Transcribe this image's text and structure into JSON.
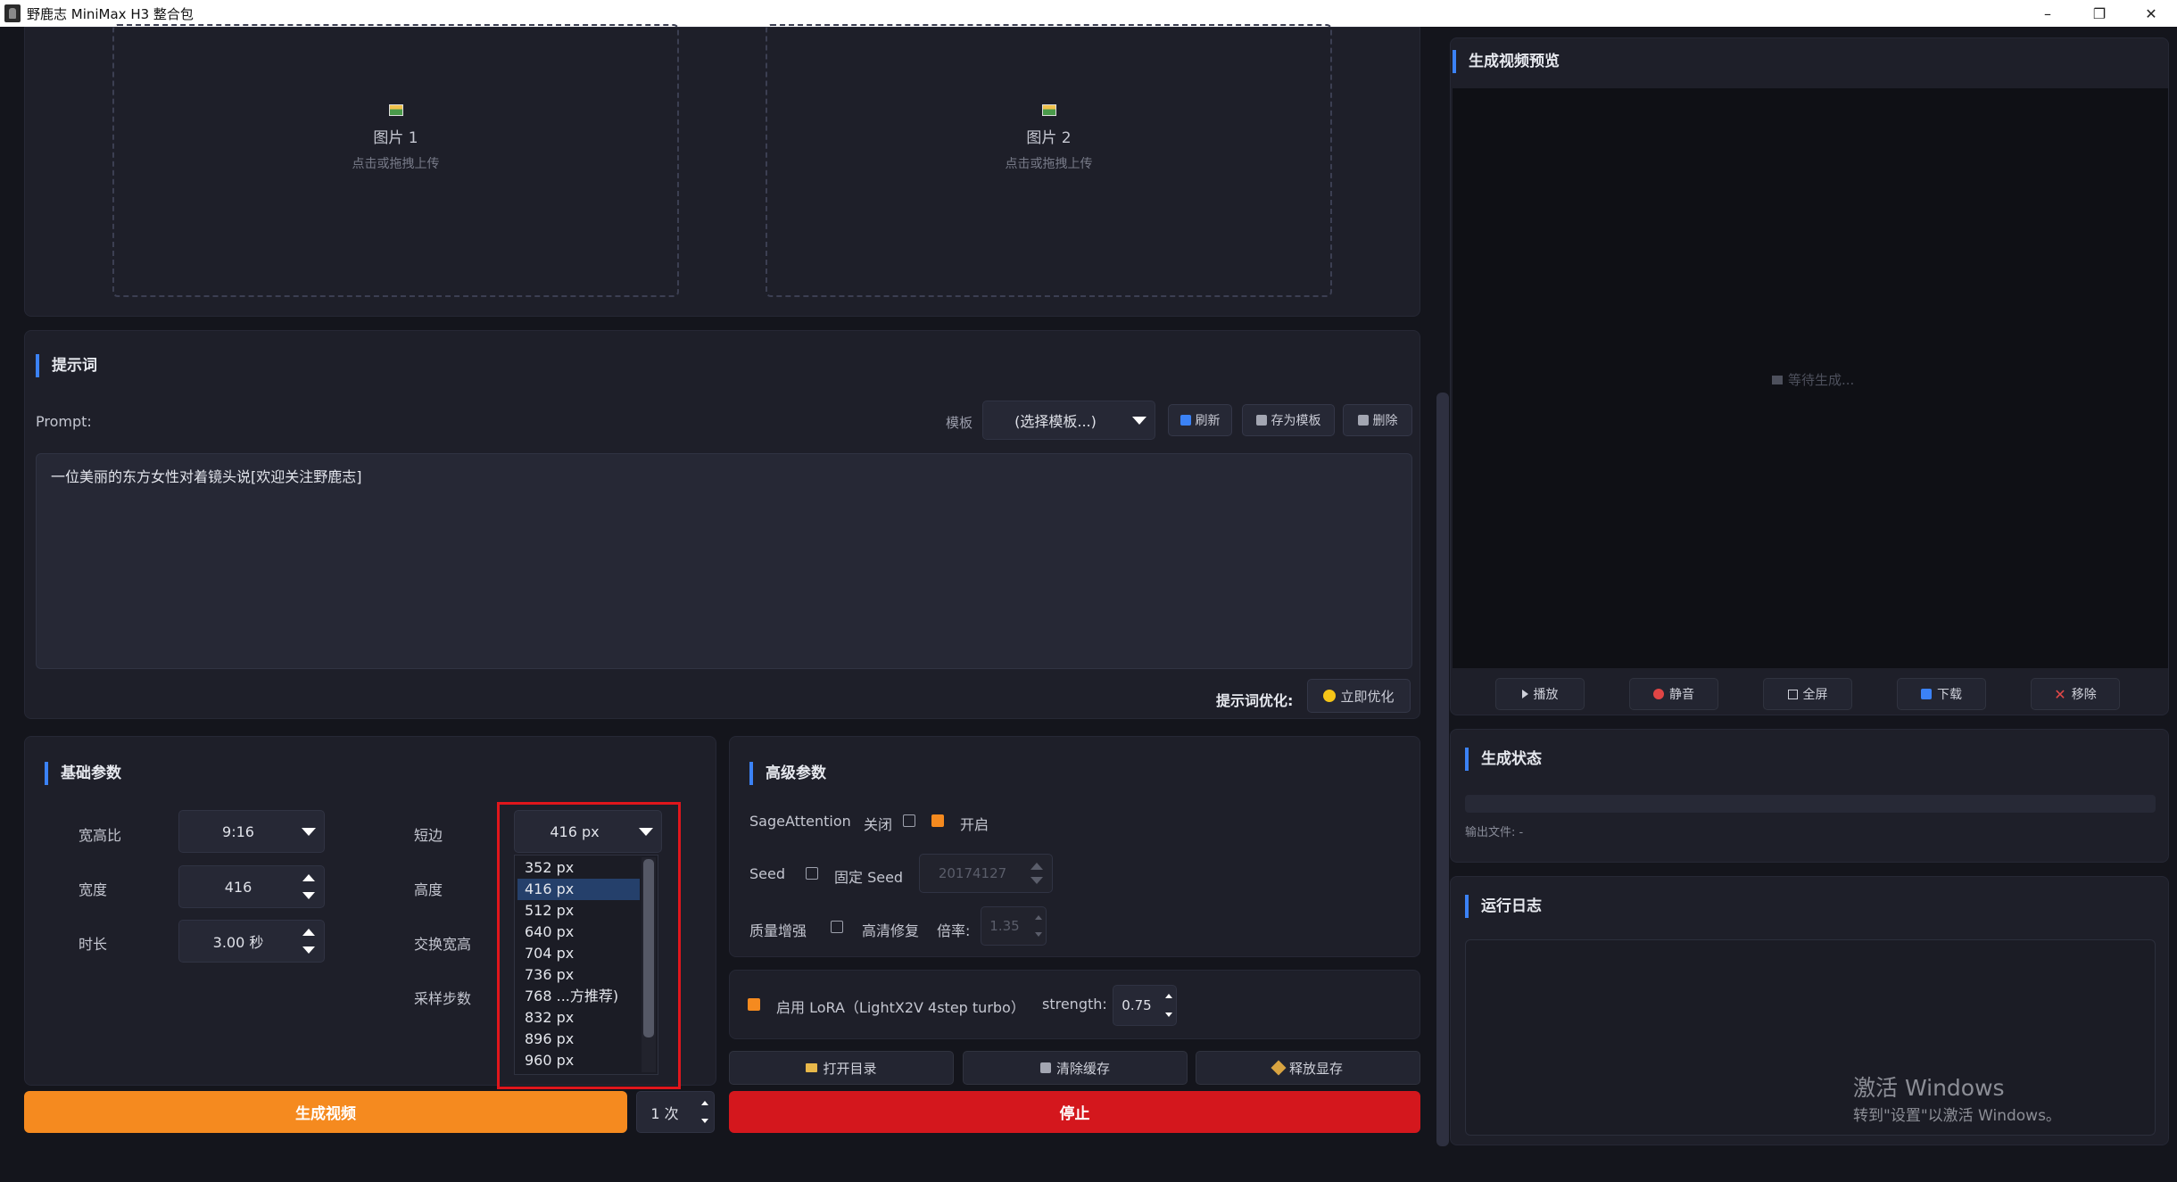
{
  "window": {
    "title": "野鹿志 MiniMax H3 整合包",
    "minimize": "–",
    "restore": "❐",
    "close": "✕"
  },
  "upload": {
    "image1": {
      "label": "图片 1",
      "hint": "点击或拖拽上传"
    },
    "image2": {
      "label": "图片 2",
      "hint": "点击或拖拽上传"
    }
  },
  "prompt": {
    "section_title": "提示词",
    "label": "Prompt:",
    "template_label": "模板",
    "template_selected": "(选择模板...)",
    "refresh": "刷新",
    "save_template": "存为模板",
    "delete": "删除",
    "text": "一位美丽的东方女性对着镜头说[欢迎关注野鹿志]",
    "optimize_label": "提示词优化:",
    "optimize_button": "立即优化"
  },
  "basic": {
    "section_title": "基础参数",
    "aspect_label": "宽高比",
    "aspect_value": "9:16",
    "width_label": "宽度",
    "width_value": "416",
    "duration_label": "时长",
    "duration_value": "3.00 秒",
    "short_edge_label": "短边",
    "short_edge_value": "416 px",
    "height_label": "高度",
    "swap_label": "交换宽高",
    "steps_label": "采样步数",
    "short_edge_options": [
      "352 px",
      "416 px",
      "512 px",
      "640 px",
      "704 px",
      "736 px",
      "768 ...方推荐)",
      "832 px",
      "896 px",
      "960 px"
    ],
    "selected_index": 1
  },
  "advanced": {
    "section_title": "高级参数",
    "sage_label": "SageAttention",
    "sage_off": "关闭",
    "sage_on": "开启",
    "seed_label": "Seed",
    "fixed_seed": "固定 Seed",
    "seed_value": "20174127",
    "quality_label": "质量增强",
    "hd_fix": "高清修复",
    "ratio_label": "倍率:",
    "ratio_value": "1.35"
  },
  "lora": {
    "label": "启用 LoRA（LightX2V 4step turbo）",
    "strength_label": "strength:",
    "strength_value": "0.75"
  },
  "actions": {
    "open_dir": "打开目录",
    "clear_cache": "清除缓存",
    "free_vram": "释放显存",
    "generate": "生成视频",
    "count": "1 次",
    "stop": "停止"
  },
  "preview": {
    "section_title": "生成视频预览",
    "waiting": "等待生成...",
    "play": "播放",
    "mute": "静音",
    "fullscreen": "全屏",
    "download": "下载",
    "remove": "移除"
  },
  "status": {
    "section_title": "生成状态",
    "output_file": "输出文件: -"
  },
  "log": {
    "section_title": "运行日志"
  },
  "watermark": {
    "line1": "激活 Windows",
    "line2": "转到\"设置\"以激活 Windows。"
  },
  "colors": {
    "accent_blue": "#3b82f6",
    "orange": "#f58a1f",
    "red": "#d4171d",
    "highlight_red": "#e0161c"
  }
}
